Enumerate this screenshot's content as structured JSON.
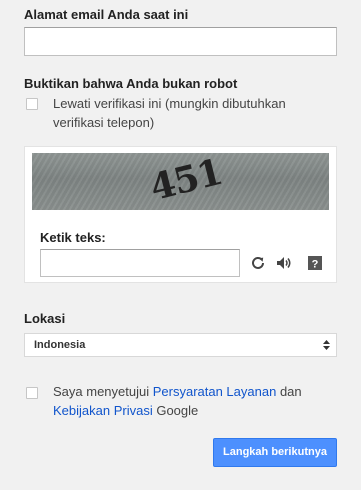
{
  "email": {
    "label": "Alamat email Anda saat ini",
    "value": ""
  },
  "robot": {
    "heading": "Buktikan bahwa Anda bukan robot",
    "skip_label_line1": "Lewati verifikasi ini (mungkin dibutuhkan",
    "skip_label_line2": "verifikasi telepon)",
    "skip_checked": false
  },
  "captcha": {
    "image_text": "451",
    "type_label": "Ketik teks:",
    "value": "",
    "icons": [
      "refresh-icon",
      "audio-icon",
      "help-icon"
    ]
  },
  "location": {
    "label": "Lokasi",
    "selected": "Indonesia"
  },
  "terms": {
    "prefix": "Saya menyetujui ",
    "tos_link": "Persyaratan Layanan",
    "and": " dan",
    "privacy_link": "Kebijakan Privasi",
    "suffix": " Google",
    "checked": false
  },
  "next_button": "Langkah berikutnya",
  "colors": {
    "primary": "#4d90fe",
    "link": "#1155cc",
    "background": "#f1f1f1"
  }
}
